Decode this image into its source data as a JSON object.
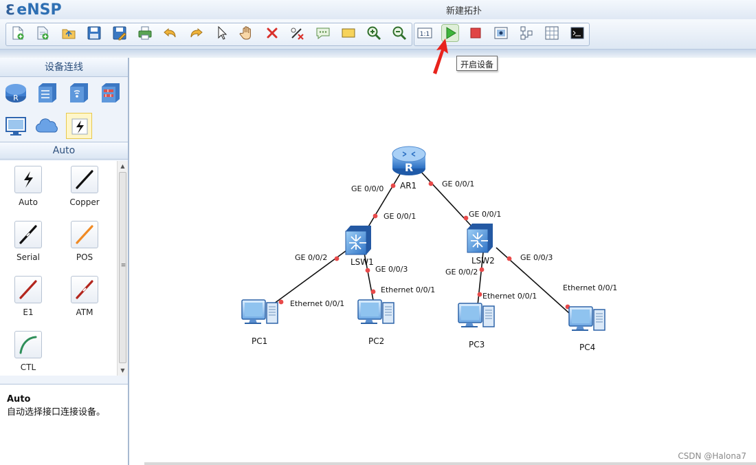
{
  "app": {
    "logo": "eNSP",
    "window_title": "新建拓扑"
  },
  "toolbar": {
    "buttons": [
      {
        "name": "new-topology",
        "icon": "new-file-icon"
      },
      {
        "name": "new-from-template",
        "icon": "new-template-icon"
      },
      {
        "name": "open",
        "icon": "open-folder-icon"
      },
      {
        "name": "save",
        "icon": "save-icon"
      },
      {
        "name": "save-as",
        "icon": "save-as-icon"
      },
      {
        "name": "print",
        "icon": "print-icon"
      },
      {
        "name": "undo",
        "icon": "undo-icon"
      },
      {
        "name": "redo",
        "icon": "redo-icon"
      },
      {
        "name": "select",
        "icon": "pointer-icon"
      },
      {
        "name": "pan",
        "icon": "hand-icon"
      },
      {
        "name": "delete",
        "icon": "delete-icon"
      },
      {
        "name": "delete-all-links",
        "icon": "delete-links-icon"
      },
      {
        "name": "text-note",
        "icon": "text-note-icon"
      },
      {
        "name": "add-shape",
        "icon": "rectangle-icon"
      },
      {
        "name": "zoom-in",
        "icon": "zoom-in-icon"
      },
      {
        "name": "zoom-out",
        "icon": "zoom-out-icon"
      },
      {
        "name": "zoom-reset",
        "icon": "zoom-actual-size-icon"
      },
      {
        "name": "start-device",
        "icon": "play-icon"
      },
      {
        "name": "stop-device",
        "icon": "stop-icon"
      },
      {
        "name": "capture",
        "icon": "capture-icon"
      },
      {
        "name": "topology-view",
        "icon": "topology-icon"
      },
      {
        "name": "grid",
        "icon": "grid-icon"
      },
      {
        "name": "console",
        "icon": "console-icon"
      }
    ],
    "tooltip": "开启设备",
    "zoom_reset_label": "1:1"
  },
  "left_panel": {
    "device_header": "设备连线",
    "device_categories": [
      {
        "name": "router",
        "icon": "router-icon"
      },
      {
        "name": "switch",
        "icon": "switch-icon"
      },
      {
        "name": "wireless",
        "icon": "wireless-ap-icon"
      },
      {
        "name": "firewall",
        "icon": "firewall-icon"
      },
      {
        "name": "terminal",
        "icon": "pc-icon"
      },
      {
        "name": "cloud",
        "icon": "cloud-icon"
      },
      {
        "name": "connection",
        "icon": "cable-icon",
        "selected": true
      }
    ],
    "section_title": "Auto",
    "cables": [
      {
        "label": "Auto",
        "icon": "auto-cable-icon"
      },
      {
        "label": "Copper",
        "icon": "copper-cable-icon"
      },
      {
        "label": "Serial",
        "icon": "serial-cable-icon"
      },
      {
        "label": "POS",
        "icon": "pos-cable-icon"
      },
      {
        "label": "E1",
        "icon": "e1-cable-icon"
      },
      {
        "label": "ATM",
        "icon": "atm-cable-icon"
      },
      {
        "label": "CTL",
        "icon": "ctl-cable-icon"
      }
    ],
    "description": {
      "title": "Auto",
      "text": "自动选择接口连接设备。"
    }
  },
  "topology": {
    "devices": [
      {
        "id": "AR1",
        "label": "AR1",
        "type": "router"
      },
      {
        "id": "LSW1",
        "label": "LSW1",
        "type": "switch"
      },
      {
        "id": "LSW2",
        "label": "LSW2",
        "type": "switch"
      },
      {
        "id": "PC1",
        "label": "PC1",
        "type": "pc"
      },
      {
        "id": "PC2",
        "label": "PC2",
        "type": "pc"
      },
      {
        "id": "PC3",
        "label": "PC3",
        "type": "pc"
      },
      {
        "id": "PC4",
        "label": "PC4",
        "type": "pc"
      }
    ],
    "links": [
      {
        "from": "AR1",
        "from_port": "GE 0/0/0",
        "to": "LSW1",
        "to_port": "GE 0/0/1"
      },
      {
        "from": "AR1",
        "from_port": "GE 0/0/1",
        "to": "LSW2",
        "to_port": "GE 0/0/1"
      },
      {
        "from": "LSW1",
        "from_port": "GE 0/0/2",
        "to": "PC1",
        "to_port": "Ethernet 0/0/1"
      },
      {
        "from": "LSW1",
        "from_port": "GE 0/0/3",
        "to": "PC2",
        "to_port": "Ethernet 0/0/1"
      },
      {
        "from": "LSW2",
        "from_port": "GE 0/0/2",
        "to": "PC3",
        "to_port": "Ethernet 0/0/1"
      },
      {
        "from": "LSW2",
        "from_port": "GE 0/0/3",
        "to": "PC4",
        "to_port": "Ethernet 0/0/1"
      }
    ]
  },
  "watermark": "CSDN @Halona7"
}
